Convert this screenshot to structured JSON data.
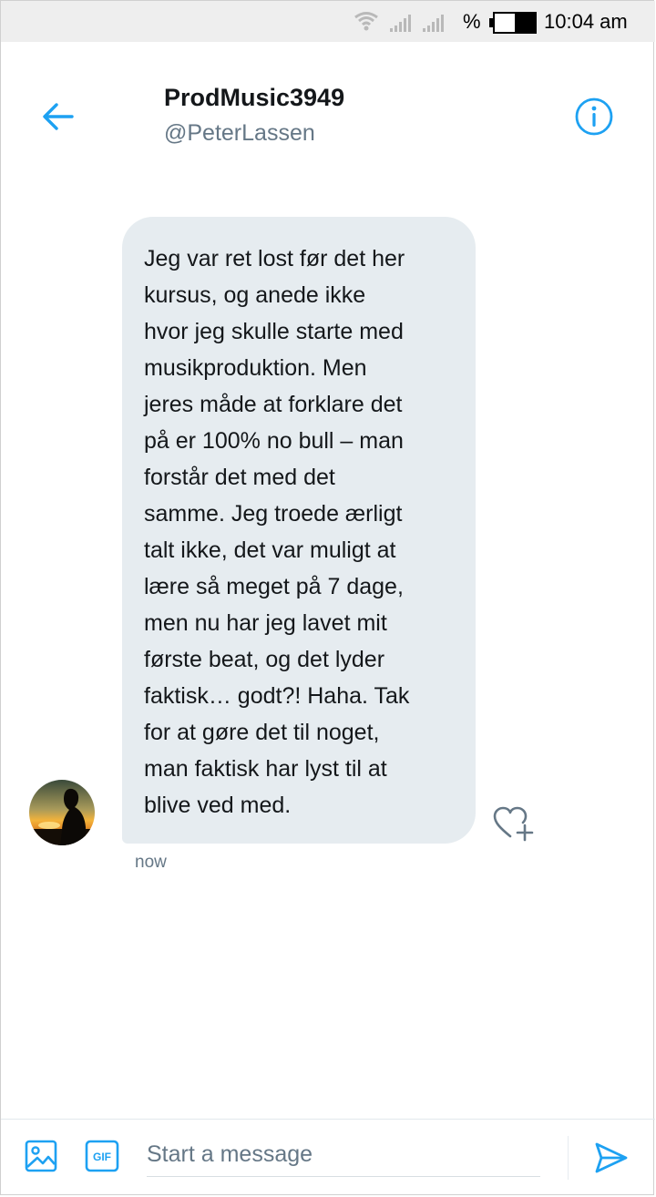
{
  "status_bar": {
    "battery_percent_symbol": "%",
    "time": "10:04 am"
  },
  "header": {
    "display_name": "ProdMusic3949",
    "handle": "@PeterLassen"
  },
  "message": {
    "text": "Jeg var ret lost før det her\nkursus, og anede ikke\nhvor jeg skulle starte med\nmusikproduktion. Men\njeres måde at forklare det\npå er 100% no bull – man\nforstår det med det\nsamme. Jeg troede ærligt\ntalt ikke, det var muligt at\nlære så meget på 7 dage,\nmen nu har jeg lavet mit\nførste beat, og det lyder\nfaktisk… godt?! Haha. Tak\nfor at gøre det til noget,\nman faktisk har lyst til at\nblive ved med.",
    "timestamp": "now"
  },
  "composer": {
    "placeholder": "Start a message",
    "value": ""
  },
  "icons": {
    "back": "arrow-left-icon",
    "info": "info-icon",
    "like": "heart-add-icon",
    "media": "image-icon",
    "gif": "gif-icon",
    "send": "send-icon"
  },
  "colors": {
    "accent": "#1da1f2",
    "bubble": "#e6ecf0",
    "text": "#14171a",
    "muted": "#657786",
    "status_bar_bg": "#eeeeee"
  }
}
